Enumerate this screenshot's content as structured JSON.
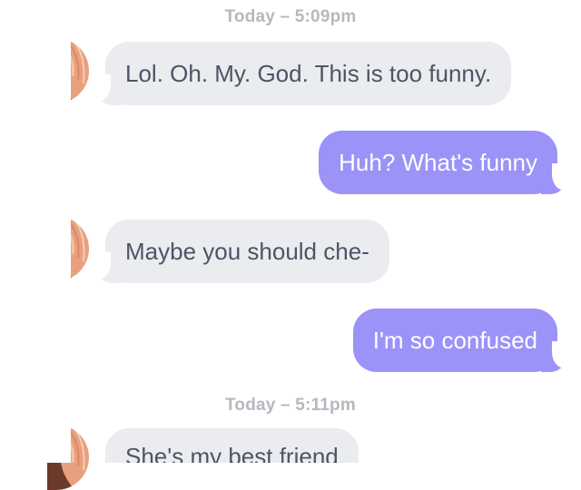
{
  "conversation": {
    "timestamps": [
      "Today – 5:09pm",
      "Today – 5:11pm"
    ],
    "messages": [
      {
        "direction": "incoming",
        "text": "Lol. Oh. My. God. This is too funny."
      },
      {
        "direction": "outgoing",
        "text": "Huh? What's funny"
      },
      {
        "direction": "incoming",
        "text": "Maybe you should che-"
      },
      {
        "direction": "outgoing",
        "text": "I'm so confused"
      },
      {
        "direction": "incoming",
        "text": "She's my best friend"
      }
    ]
  },
  "colors": {
    "incoming_bubble": "#ebecf0",
    "incoming_text": "#4c5565",
    "outgoing_bubble": "#9b93f7",
    "outgoing_text": "#ffffff",
    "timestamp_text": "#b7b8bf",
    "avatar_skin": "#e9a07f"
  },
  "icons": {
    "avatar": "contact-avatar-photo"
  }
}
